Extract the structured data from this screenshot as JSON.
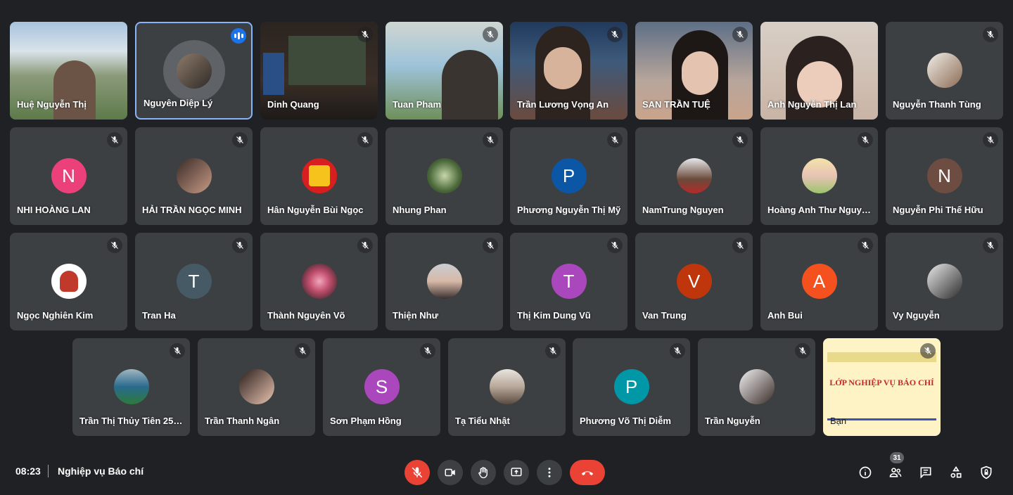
{
  "meeting": {
    "time": "08:23",
    "title": "Nghiệp vụ Báo chí",
    "participant_count": "31"
  },
  "colors": {
    "accent": "#8ab4f8",
    "danger": "#ea4335",
    "tile": "#3c4043",
    "background": "#202124"
  },
  "participants": [
    {
      "name": "Huệ Nguyễn Thị"
    },
    {
      "name": "Nguyên Diệp Lý"
    },
    {
      "name": "Dinh Quang"
    },
    {
      "name": "Tuan Pham"
    },
    {
      "name": "Trần Lương Vọng An"
    },
    {
      "name": "SAN TRẦN TUỆ"
    },
    {
      "name": "Anh Nguyễn Thị Lan"
    },
    {
      "name": "Nguyễn Thanh Tùng"
    },
    {
      "name": "NHI HOÀNG LAN",
      "initial": "N"
    },
    {
      "name": "HẢI TRẦN NGỌC MINH"
    },
    {
      "name": "Hân Nguyễn Bùi Ngọc"
    },
    {
      "name": "Nhung Phan"
    },
    {
      "name": "Phương Nguyễn Thị Mỹ",
      "initial": "P"
    },
    {
      "name": "NamTrung Nguyen"
    },
    {
      "name": "Hoàng Anh Thư Nguyễn"
    },
    {
      "name": "Nguyễn Phi Thế Hữu",
      "initial": "N"
    },
    {
      "name": "Ngọc Nghiên Kim"
    },
    {
      "name": "Tran Ha",
      "initial": "T"
    },
    {
      "name": "Thành Nguyên Võ"
    },
    {
      "name": "Thiện Như"
    },
    {
      "name": "Thị Kim Dung Vũ",
      "initial": "T"
    },
    {
      "name": "Van Trung",
      "initial": "V"
    },
    {
      "name": "Anh Bui",
      "initial": "A"
    },
    {
      "name": "Vy Nguyễn"
    },
    {
      "name": "Trần Thị Thủy Tiên 255..."
    },
    {
      "name": "Trần Thanh Ngân"
    },
    {
      "name": "Sơn Phạm Hồng",
      "initial": "S"
    },
    {
      "name": "Tạ Tiểu Nhật"
    },
    {
      "name": "Phương Võ Thị Diễm",
      "initial": "P"
    },
    {
      "name": "Trần Nguyễn"
    },
    {
      "name": "Bạn"
    }
  ],
  "banner_text": [
    "LỚP NGHIỆP VỤ BÁO CHÍ"
  ]
}
